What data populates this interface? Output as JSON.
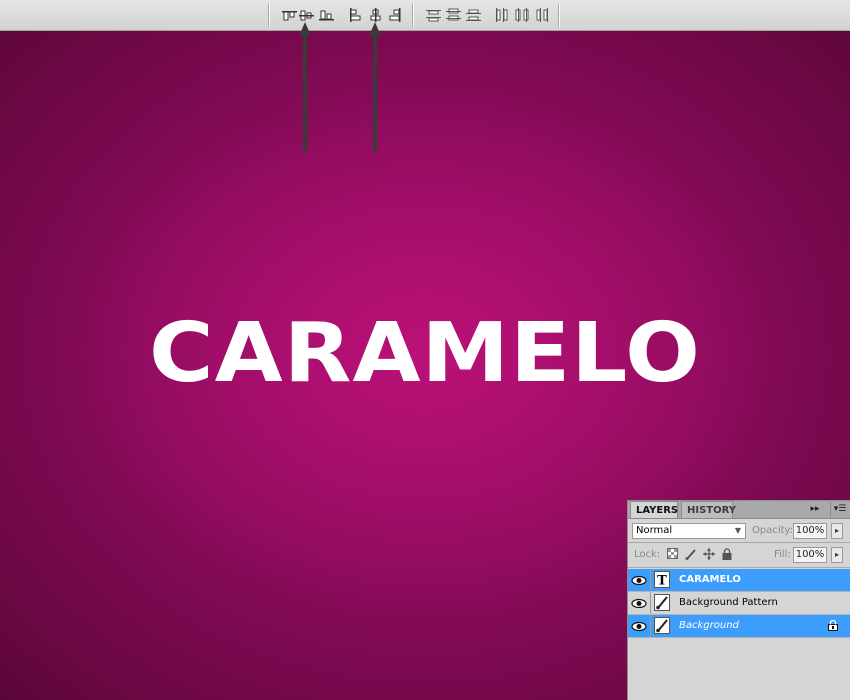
{
  "canvas": {
    "text": "CARAMELO",
    "background_color": "#8c0b5c",
    "text_color": "#ffffff"
  },
  "options_bar": {
    "groups": [
      {
        "name": "align",
        "icons": [
          "align-top-edges-icon",
          "align-vertical-centers-icon",
          "align-bottom-edges-icon",
          "align-left-edges-icon",
          "align-horizontal-centers-icon",
          "align-right-edges-icon"
        ]
      },
      {
        "name": "distribute",
        "icons": [
          "distribute-top-edges-icon",
          "distribute-vertical-centers-icon",
          "distribute-bottom-edges-icon",
          "distribute-left-edges-icon",
          "distribute-horizontal-centers-icon",
          "distribute-right-edges-icon"
        ]
      }
    ]
  },
  "layers_panel": {
    "tabs": [
      "LAYERS",
      "HISTORY"
    ],
    "active_tab": "LAYERS",
    "blend_mode": "Normal",
    "opacity_label": "Opacity:",
    "opacity_value": "100%",
    "lock_label": "Lock:",
    "fill_label": "Fill:",
    "fill_value": "100%",
    "layers": [
      {
        "name": "CARAMELO",
        "type": "text",
        "selected": true,
        "visible": true,
        "locked": false
      },
      {
        "name": "Background Pattern",
        "type": "raster",
        "selected": false,
        "visible": true,
        "locked": false
      },
      {
        "name": "Background",
        "type": "raster",
        "selected": true,
        "visible": true,
        "locked": true
      }
    ],
    "selection_color": "#3d9dfc"
  }
}
